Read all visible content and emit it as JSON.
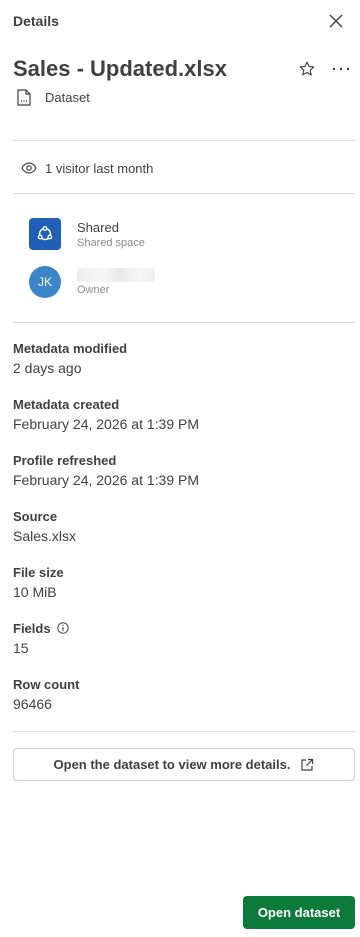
{
  "header": {
    "title": "Details"
  },
  "file": {
    "name": "Sales - Updated.xlsx",
    "type_label": "Dataset"
  },
  "visitors": {
    "text": "1 visitor last month"
  },
  "spaces": [
    {
      "name": "Shared",
      "subtitle": "Shared space",
      "icon": "shared-space-icon",
      "color": "#1f5fb5"
    },
    {
      "name": "",
      "subtitle": "Owner",
      "avatar_initials": "JK",
      "color": "#3a86c8"
    }
  ],
  "properties": {
    "metadata_modified": {
      "label": "Metadata modified",
      "value": "2 days ago"
    },
    "metadata_created": {
      "label": "Metadata created",
      "value": "February 24, 2026 at 1:39 PM"
    },
    "profile_refreshed": {
      "label": "Profile refreshed",
      "value": "February 24, 2026 at 1:39 PM"
    },
    "source": {
      "label": "Source",
      "value": "Sales.xlsx"
    },
    "file_size": {
      "label": "File size",
      "value": "10 MiB"
    },
    "fields": {
      "label": "Fields",
      "value": "15",
      "info_icon": "info-icon"
    },
    "row_count": {
      "label": "Row count",
      "value": "96466"
    }
  },
  "actions": {
    "open_details_label": "Open the dataset to view more details.",
    "open_dataset_label": "Open dataset",
    "primary_color": "#0b7a3a"
  }
}
